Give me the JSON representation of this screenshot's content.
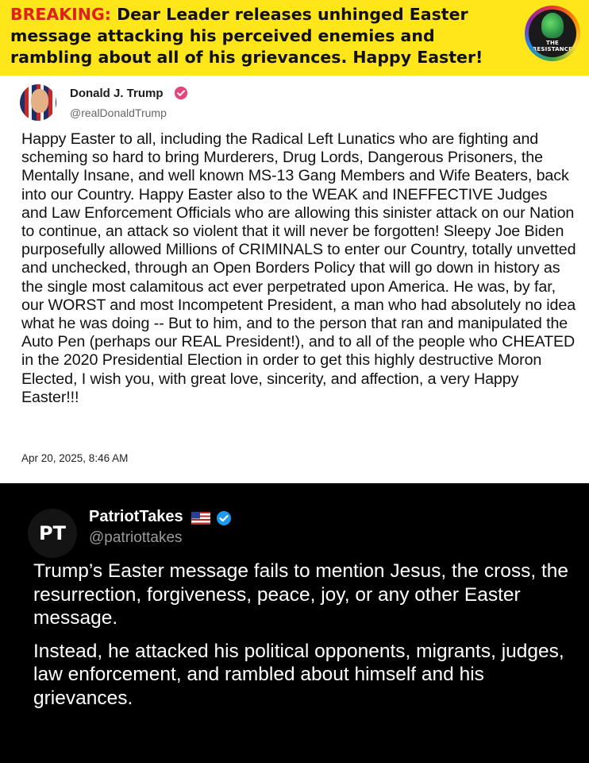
{
  "banner": {
    "breaking_label": "BREAKING:",
    "headline": "Dear Leader releases unhinged Easter message attacking his perceived enemies and rambling about all of his grievances. Happy Easter!",
    "logo_text_line1": "THE",
    "logo_text_line2": "RESISTANCE"
  },
  "post1": {
    "display_name": "Donald J. Trump",
    "handle": "@realDonaldTrump",
    "verified_color": "#e6447a",
    "body": "Happy Easter to all, including the Radical Left Lunatics who are fighting and scheming so hard to bring Murderers, Drug Lords, Dangerous Prisoners, the Mentally Insane, and well known MS-13 Gang Members and Wife Beaters, back into our Country. Happy Easter also to the WEAK and INEFFECTIVE Judges and Law Enforcement Officials who are allowing this sinister attack on our Nation to continue, an attack so violent that it will never be forgotten! Sleepy Joe Biden purposefully allowed Millions of CRIMINALS to enter our Country, totally unvetted and unchecked, through an Open Borders Policy that will go down in history as the single most calamitous act ever perpetrated upon America. He was, by far, our WORST and most Incompetent President, a man who had absolutely no idea what he was doing -- But to him, and to the person that ran and manipulated the Auto Pen (perhaps our REAL President!), and to all of the people who CHEATED in the 2020 Presidential Election in order to get this highly destructive Moron Elected, I wish you, with great love, sincerity, and affection, a very Happy Easter!!!",
    "timestamp": "Apr 20, 2025, 8:46 AM"
  },
  "post2": {
    "avatar_text": "PT",
    "display_name": "PatriotTakes",
    "handle": "@patriottakes",
    "verified_color": "#1d9bf0",
    "paragraph1": "Trump’s Easter message fails to mention Jesus, the cross, the resurrection, forgiveness, peace, joy, or any other Easter message.",
    "paragraph2": "Instead, he attacked his political opponents, migrants, judges, law enforcement, and rambled about himself and his grievances."
  },
  "colors": {
    "banner_bg": "#ffe61a",
    "breaking_red": "#e0201b",
    "card2_bg": "#000000"
  }
}
